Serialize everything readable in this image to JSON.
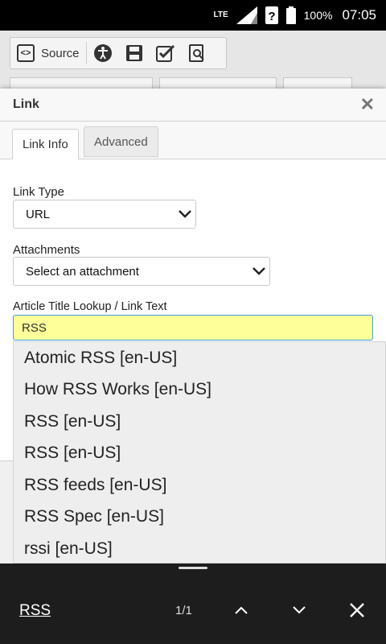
{
  "status_bar": {
    "network": "LTE",
    "battery": "100%",
    "time": "07:05"
  },
  "toolbar": {
    "source_label": "Source"
  },
  "dialog": {
    "title": "Link",
    "tabs": [
      {
        "label": "Link Info",
        "active": true
      },
      {
        "label": "Advanced",
        "active": false
      }
    ],
    "link_type_label": "Link Type",
    "link_type_value": "URL",
    "attachments_label": "Attachments",
    "attachments_value": "Select an attachment",
    "lookup_label": "Article Title Lookup / Link Text",
    "lookup_value": "RSS"
  },
  "autocomplete": {
    "items": [
      "Atomic RSS [en-US]",
      "How RSS Works [en-US]",
      "RSS [en-US]",
      "RSS [en-US]",
      "RSS feeds [en-US]",
      "RSS Spec [en-US]",
      "rssi [en-US]"
    ]
  },
  "find_bar": {
    "term": "RSS",
    "count": "1/1"
  },
  "colors": {
    "input_highlight": "#ffff99",
    "input_focus_border": "#3e9ce6",
    "find_bar_bg": "#1d1d1d"
  }
}
